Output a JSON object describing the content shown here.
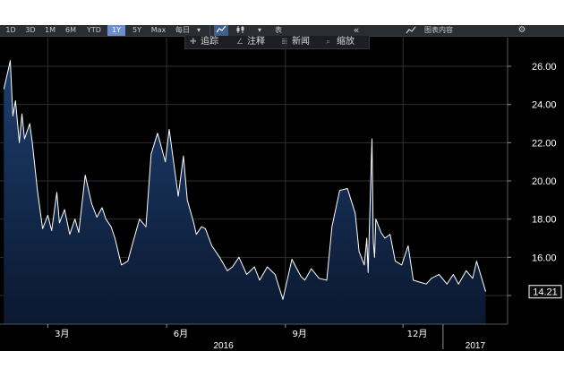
{
  "toolbar": {
    "ranges": [
      "1D",
      "3D",
      "1M",
      "6M",
      "YTD",
      "1Y",
      "5Y",
      "Max"
    ],
    "active_range": "1Y",
    "frequency": "每日",
    "chart_type_label": "表",
    "collapse": "«",
    "panel_label": "图表内容",
    "settings_icon": "gear-icon"
  },
  "subtoolbar": {
    "items": [
      {
        "icon": "crosshair-icon",
        "label": "追踪"
      },
      {
        "icon": "pen-icon",
        "label": "注释"
      },
      {
        "icon": "news-icon",
        "label": "新闻"
      },
      {
        "icon": "magnifier-icon",
        "label": "缩放"
      }
    ]
  },
  "colors": {
    "background": "#000000",
    "line": "#ffffff",
    "fill_top": "#1d3f6e",
    "fill_bottom": "#0b1830",
    "grid": "#2c2f33"
  },
  "chart_data": {
    "type": "area",
    "title": "",
    "xlabel": "",
    "ylabel": "",
    "ylim": [
      12.5,
      27.5
    ],
    "y_ticks": [
      14,
      16,
      18,
      20,
      22,
      24,
      26
    ],
    "y_tick_labels": [
      "16.00",
      "18.00",
      "20.00",
      "22.00",
      "24.00",
      "26.00"
    ],
    "grid": true,
    "x_month_labels": [
      "3月",
      "6月",
      "9月",
      "12月"
    ],
    "x_year_labels": [
      "2016",
      "2017"
    ],
    "last_value_label": "14.21",
    "x": [
      "2016-01-27",
      "2016-02-01",
      "2016-02-03",
      "2016-02-05",
      "2016-02-08",
      "2016-02-10",
      "2016-02-12",
      "2016-02-16",
      "2016-02-18",
      "2016-02-22",
      "2016-02-24",
      "2016-02-26",
      "2016-03-01",
      "2016-03-04",
      "2016-03-08",
      "2016-03-10",
      "2016-03-14",
      "2016-03-18",
      "2016-03-22",
      "2016-03-25",
      "2016-03-30",
      "2016-04-04",
      "2016-04-08",
      "2016-04-12",
      "2016-04-15",
      "2016-04-19",
      "2016-04-22",
      "2016-04-27",
      "2016-05-02",
      "2016-05-06",
      "2016-05-11",
      "2016-05-16",
      "2016-05-20",
      "2016-05-25",
      "2016-05-31",
      "2016-06-03",
      "2016-06-08",
      "2016-06-10",
      "2016-06-14",
      "2016-06-17",
      "2016-06-22",
      "2016-06-24",
      "2016-06-28",
      "2016-07-01",
      "2016-07-06",
      "2016-07-12",
      "2016-07-18",
      "2016-07-22",
      "2016-07-27",
      "2016-08-02",
      "2016-08-08",
      "2016-08-12",
      "2016-08-18",
      "2016-08-24",
      "2016-08-30",
      "2016-09-06",
      "2016-09-09",
      "2016-09-13",
      "2016-09-16",
      "2016-09-21",
      "2016-09-27",
      "2016-10-03",
      "2016-10-07",
      "2016-10-13",
      "2016-10-19",
      "2016-10-25",
      "2016-10-28",
      "2016-11-01",
      "2016-11-03",
      "2016-11-04",
      "2016-11-07",
      "2016-11-08",
      "2016-11-09",
      "2016-11-10",
      "2016-11-14",
      "2016-11-17",
      "2016-11-21",
      "2016-11-25",
      "2016-11-30",
      "2016-12-05",
      "2016-12-09",
      "2016-12-14",
      "2016-12-19",
      "2016-12-23",
      "2016-12-29",
      "2017-01-04",
      "2017-01-09",
      "2017-01-13",
      "2017-01-19",
      "2017-01-24",
      "2017-01-27",
      "2017-01-31",
      "2017-02-03"
    ],
    "series": [
      {
        "values": [
          24.8,
          26.3,
          23.4,
          24.2,
          22.0,
          23.5,
          22.2,
          23.0,
          22.0,
          19.5,
          18.5,
          17.5,
          18.2,
          17.4,
          19.4,
          17.8,
          18.5,
          17.2,
          18.0,
          17.3,
          20.3,
          18.8,
          18.1,
          18.6,
          18.0,
          17.6,
          17.0,
          15.6,
          15.8,
          16.8,
          18.0,
          17.6,
          21.4,
          22.5,
          21.0,
          22.7,
          20.2,
          19.2,
          21.3,
          19.0,
          17.8,
          17.2,
          17.6,
          17.5,
          16.6,
          16.0,
          15.3,
          15.5,
          16.0,
          15.1,
          15.5,
          14.8,
          15.5,
          15.1,
          13.8,
          15.9,
          15.5,
          15.0,
          14.8,
          15.4,
          14.9,
          14.8,
          17.6,
          19.5,
          19.6,
          18.3,
          16.3,
          15.6,
          17.0,
          15.2,
          22.2,
          16.8,
          16.0,
          18.0,
          17.3,
          17.0,
          17.2,
          15.8,
          15.6,
          16.6,
          14.8,
          14.7,
          14.6,
          14.9,
          15.1,
          14.6,
          15.1,
          14.6,
          15.3,
          14.9,
          15.8,
          14.9,
          14.2
        ]
      }
    ]
  }
}
